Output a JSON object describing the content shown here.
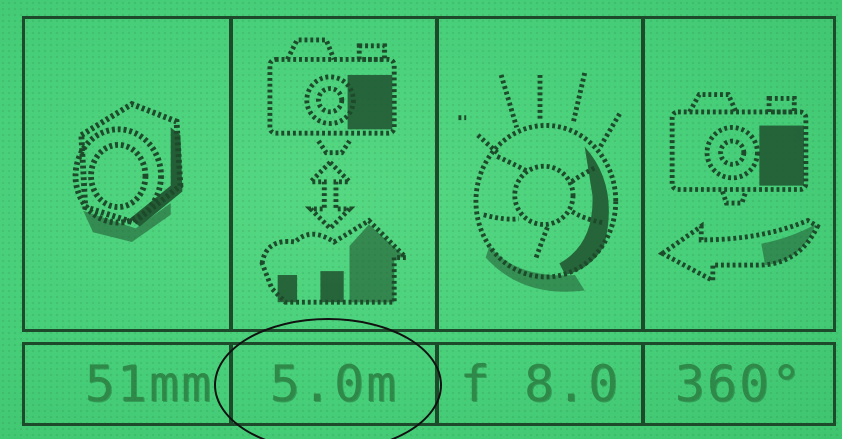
{
  "display": {
    "cells": [
      {
        "name": "focal-length",
        "icon": "lens-icon",
        "value": "51mm"
      },
      {
        "name": "focus-distance",
        "icon": "focus-distance-icon",
        "value": "5.0m"
      },
      {
        "name": "aperture",
        "icon": "aperture-icon",
        "value": "f 8.0"
      },
      {
        "name": "rotation",
        "icon": "rotate-camera-icon",
        "value": "360°"
      }
    ]
  },
  "colors": {
    "lcd_background": "#48cf7a",
    "lcd_ink": "#1d4a2a",
    "value_text": "#2f8a4a",
    "annotation": "#111111"
  }
}
